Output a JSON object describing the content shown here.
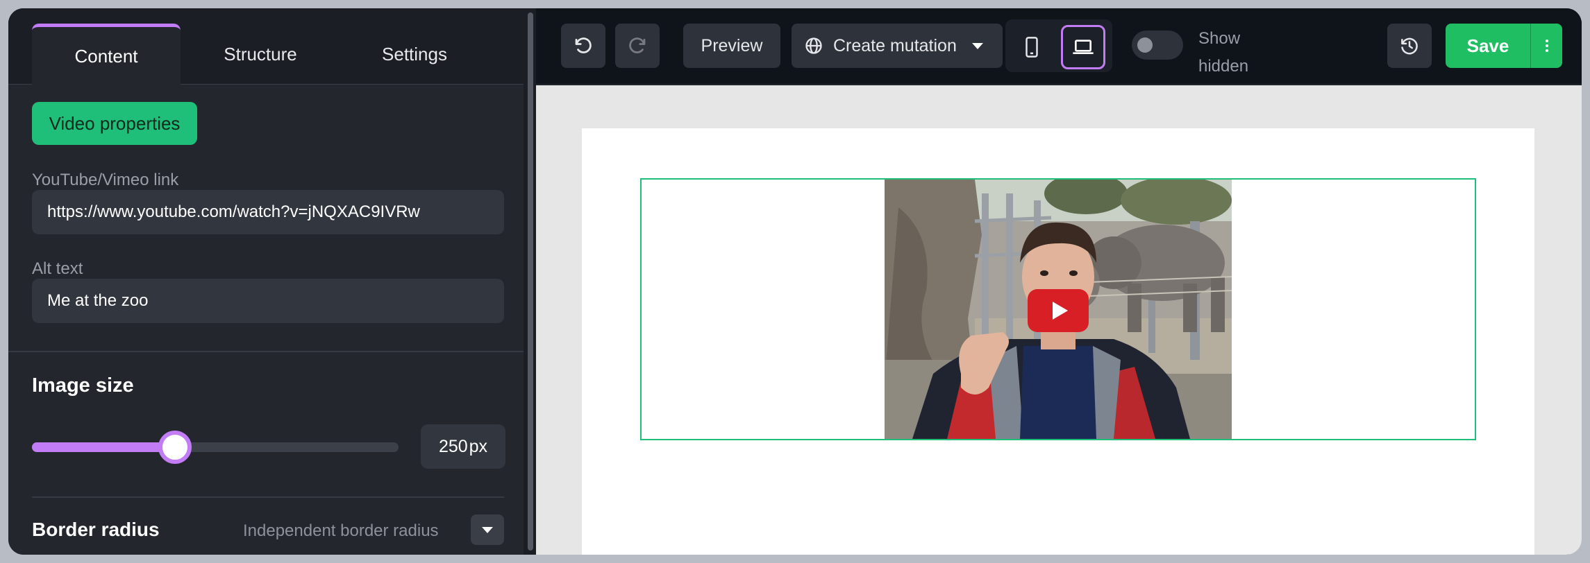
{
  "tabs": [
    {
      "label": "Content",
      "active": true
    },
    {
      "label": "Structure",
      "active": false
    },
    {
      "label": "Settings",
      "active": false
    }
  ],
  "content": {
    "section_button": "Video properties",
    "link": {
      "label": "YouTube/Vimeo link",
      "value": "https://www.youtube.com/watch?v=jNQXAC9IVRw"
    },
    "alt": {
      "label": "Alt text",
      "value": "Me at the zoo"
    },
    "image_size": {
      "title": "Image size",
      "value": "250",
      "unit": "px",
      "slider_fraction": 0.39
    },
    "border_radius": {
      "title": "Border radius",
      "mode": "Independent border radius"
    }
  },
  "toolbar": {
    "undo_icon": "undo-icon",
    "redo_icon": "redo-icon",
    "preview_label": "Preview",
    "mutation_label": "Create mutation",
    "mutation_icon": "globe-icon",
    "device_options": [
      "mobile",
      "desktop"
    ],
    "selected_device": "desktop",
    "show_hidden_label": "Show hidden",
    "show_hidden_on": false,
    "history_icon": "history-icon",
    "save_label": "Save"
  },
  "canvas": {
    "video": {
      "play_icon": "play-icon"
    }
  },
  "colors": {
    "accent_purple": "#c17cf6",
    "accent_green": "#1fbe79",
    "save_green": "#1fbe63",
    "panel_bg": "#23262d",
    "toolbar_bg": "#0f131a",
    "play_red": "#d81f26"
  }
}
